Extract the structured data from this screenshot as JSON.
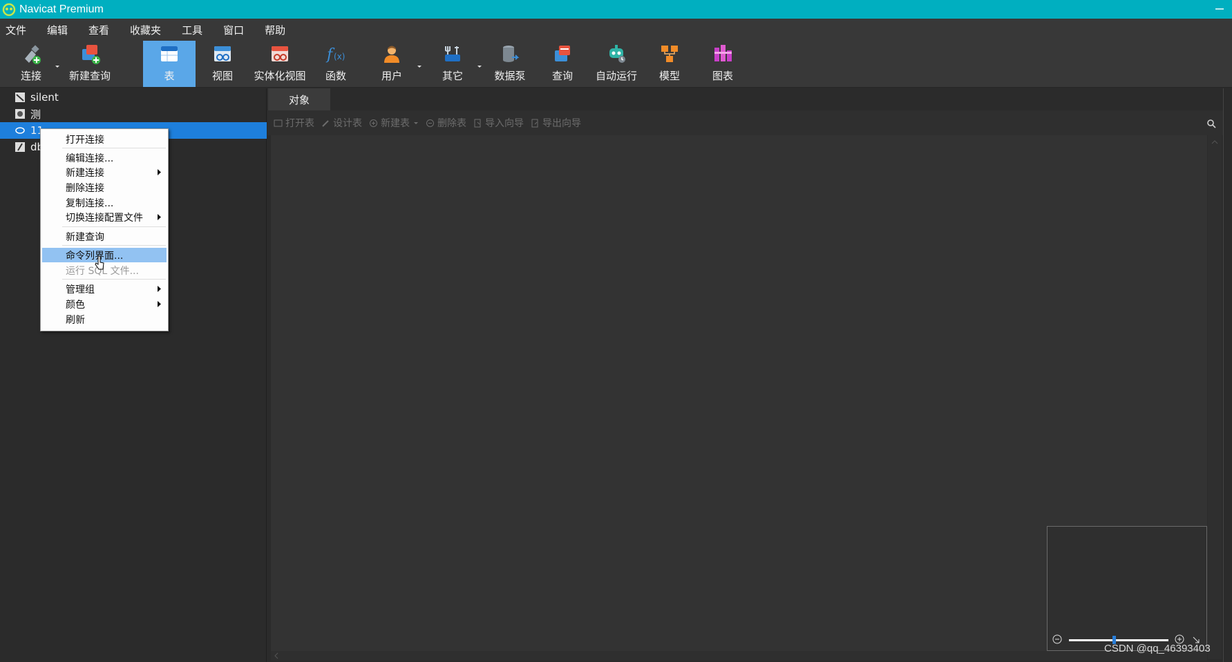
{
  "titlebar": {
    "title": "Navicat Premium"
  },
  "menubar": {
    "items": [
      "文件",
      "编辑",
      "查看",
      "收藏夹",
      "工具",
      "窗口",
      "帮助"
    ]
  },
  "toolbar": {
    "tools": [
      {
        "label": "连接",
        "icon": "connection-icon"
      },
      {
        "label": "新建查询",
        "icon": "new-query-icon"
      },
      {
        "label": "表",
        "icon": "table-icon"
      },
      {
        "label": "视图",
        "icon": "view-icon"
      },
      {
        "label": "实体化视图",
        "icon": "materialized-view-icon"
      },
      {
        "label": "函数",
        "icon": "function-icon"
      },
      {
        "label": "用户",
        "icon": "user-icon"
      },
      {
        "label": "其它",
        "icon": "others-icon"
      },
      {
        "label": "数据泵",
        "icon": "data-pump-icon"
      },
      {
        "label": "查询",
        "icon": "query-icon"
      },
      {
        "label": "自动运行",
        "icon": "automation-icon"
      },
      {
        "label": "模型",
        "icon": "model-icon"
      },
      {
        "label": "图表",
        "icon": "chart-icon"
      }
    ],
    "active": "表"
  },
  "tree": {
    "items": [
      {
        "name": "silent",
        "icon": "mysql-connection-icon"
      },
      {
        "name": "测",
        "icon": "connection-icon"
      },
      {
        "name": "11",
        "icon": "connection-icon",
        "selected": true
      },
      {
        "name": "db",
        "icon": "connection-icon"
      }
    ]
  },
  "tabs": {
    "objects": "对象"
  },
  "object_toolbar": {
    "open_table": "打开表",
    "design_table": "设计表",
    "new_table": "新建表",
    "delete_table": "删除表",
    "import_wizard": "导入向导",
    "export_wizard": "导出向导"
  },
  "context_menu": {
    "items": [
      {
        "label": "打开连接"
      },
      {
        "label": "编辑连接..."
      },
      {
        "label": "新建连接",
        "submenu": true
      },
      {
        "label": "删除连接"
      },
      {
        "label": "复制连接..."
      },
      {
        "label": "切换连接配置文件",
        "submenu": true
      },
      {
        "label": "新建查询"
      },
      {
        "label": "命令列界面...",
        "hover": true
      },
      {
        "label": "运行 SQL 文件...",
        "disabled": true
      },
      {
        "label": "管理组",
        "submenu": true
      },
      {
        "label": "颜色",
        "submenu": true
      },
      {
        "label": "刷新"
      }
    ]
  },
  "watermark": "CSDN @qq_46393403",
  "colors": {
    "titlebar": "#00afc0",
    "selected": "#1e7fdc",
    "active_tool": "#5aa7e8",
    "menu_hover": "#92c2f2"
  }
}
